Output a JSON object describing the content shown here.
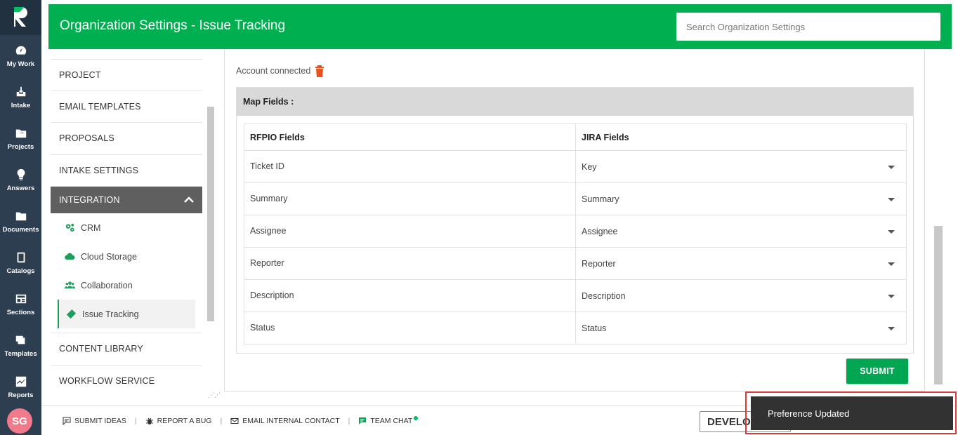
{
  "rail": {
    "items": [
      {
        "label": "My Work",
        "icon": "gauge-icon"
      },
      {
        "label": "Intake",
        "icon": "inbox-download-icon"
      },
      {
        "label": "Projects",
        "icon": "folder-icon"
      },
      {
        "label": "Answers",
        "icon": "lightbulb-icon"
      },
      {
        "label": "Documents",
        "icon": "documents-icon"
      },
      {
        "label": "Catalogs",
        "icon": "book-icon"
      },
      {
        "label": "Sections",
        "icon": "sections-icon"
      },
      {
        "label": "Templates",
        "icon": "templates-icon"
      },
      {
        "label": "Reports",
        "icon": "reports-icon"
      }
    ],
    "avatar_initials": "SG"
  },
  "header": {
    "title": "Organization Settings - Issue Tracking",
    "search_placeholder": "Search Organization Settings"
  },
  "menu": {
    "items_top": [
      "PROJECT",
      "EMAIL TEMPLATES",
      "PROPOSALS",
      "INTAKE SETTINGS"
    ],
    "active": "INTEGRATION",
    "sub_items": [
      {
        "label": "CRM",
        "icon": "gears-icon"
      },
      {
        "label": "Cloud Storage",
        "icon": "cloud-icon"
      },
      {
        "label": "Collaboration",
        "icon": "users-icon"
      },
      {
        "label": "Issue Tracking",
        "icon": "ticket-icon"
      }
    ],
    "items_bottom": [
      "CONTENT LIBRARY",
      "WORKFLOW SERVICE"
    ]
  },
  "main": {
    "account_status": "Account connected",
    "map_title": "Map Fields :",
    "columns": [
      "RFPIO Fields",
      "JIRA Fields"
    ],
    "rows": [
      {
        "rfpio": "Ticket ID",
        "jira": "Key"
      },
      {
        "rfpio": "Summary",
        "jira": "Summary"
      },
      {
        "rfpio": "Assignee",
        "jira": "Assignee"
      },
      {
        "rfpio": "Reporter",
        "jira": "Reporter"
      },
      {
        "rfpio": "Description",
        "jira": "Description"
      },
      {
        "rfpio": "Status",
        "jira": "Status"
      }
    ],
    "submit_label": "SUBMIT"
  },
  "footer": {
    "links": [
      "SUBMIT IDEAS",
      "REPORT A BUG",
      "EMAIL INTERNAL CONTACT",
      "TEAM CHAT"
    ],
    "dev_label": "DEVELOP"
  },
  "toast": {
    "message": "Preference Updated"
  },
  "colors": {
    "brand_green": "#00b050",
    "rail": "#2d3e50",
    "delete_orange": "#e84f1c",
    "toast_bg": "#323232",
    "highlight_red": "#e03a3a"
  }
}
